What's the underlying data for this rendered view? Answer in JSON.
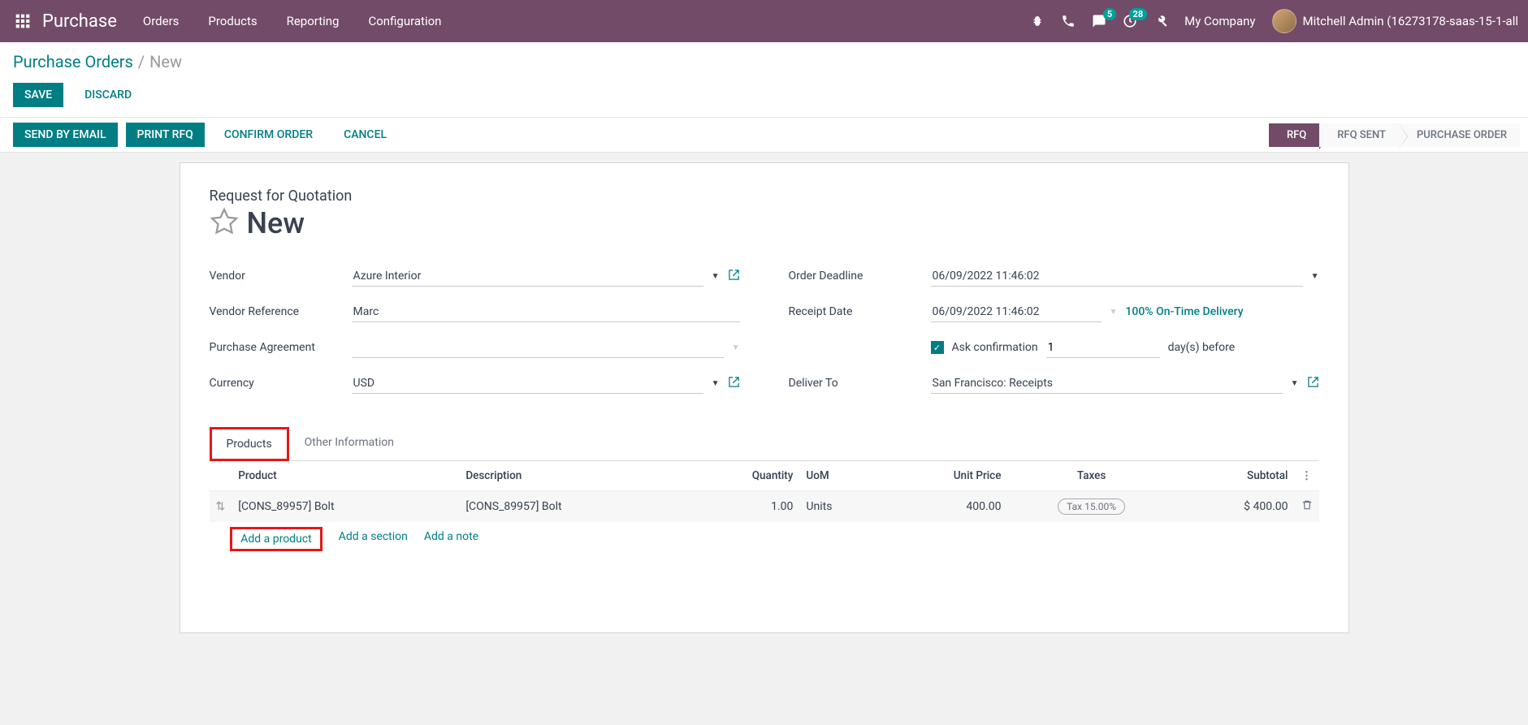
{
  "topnav": {
    "module": "Purchase",
    "menu": [
      "Orders",
      "Products",
      "Reporting",
      "Configuration"
    ],
    "messaging_badge": "5",
    "activities_badge": "28",
    "company": "My Company",
    "user": "Mitchell Admin (16273178-saas-15-1-all"
  },
  "breadcrumb": {
    "root": "Purchase Orders",
    "current": "New"
  },
  "cp_buttons": {
    "save": "SAVE",
    "discard": "DISCARD"
  },
  "statusbar_buttons": {
    "send_email": "SEND BY EMAIL",
    "print_rfq": "PRINT RFQ",
    "confirm": "CONFIRM ORDER",
    "cancel": "CANCEL"
  },
  "status_steps": [
    "RFQ",
    "RFQ SENT",
    "PURCHASE ORDER"
  ],
  "form": {
    "rfq_label": "Request for Quotation",
    "title": "New",
    "labels": {
      "vendor": "Vendor",
      "vendor_ref": "Vendor Reference",
      "agreement": "Purchase Agreement",
      "currency": "Currency",
      "deadline": "Order Deadline",
      "receipt": "Receipt Date",
      "deliver_to": "Deliver To",
      "ask_confirm": "Ask confirmation",
      "days_before": "day(s) before"
    },
    "values": {
      "vendor": "Azure Interior",
      "vendor_ref": "Marc",
      "agreement": "",
      "currency": "USD",
      "deadline": "06/09/2022 11:46:02",
      "receipt": "06/09/2022 11:46:02",
      "delivery_stat": "100% On-Time Delivery",
      "ask_days": "1",
      "deliver_to": "San Francisco: Receipts"
    }
  },
  "tabs": [
    "Products",
    "Other Information"
  ],
  "table": {
    "headers": {
      "product": "Product",
      "description": "Description",
      "quantity": "Quantity",
      "uom": "UoM",
      "unit_price": "Unit Price",
      "taxes": "Taxes",
      "subtotal": "Subtotal"
    },
    "rows": [
      {
        "product": "[CONS_89957] Bolt",
        "description": "[CONS_89957] Bolt",
        "quantity": "1.00",
        "uom": "Units",
        "unit_price": "400.00",
        "tax": "Tax 15.00%",
        "subtotal": "$ 400.00"
      }
    ],
    "add_links": {
      "product": "Add a product",
      "section": "Add a section",
      "note": "Add a note"
    }
  }
}
